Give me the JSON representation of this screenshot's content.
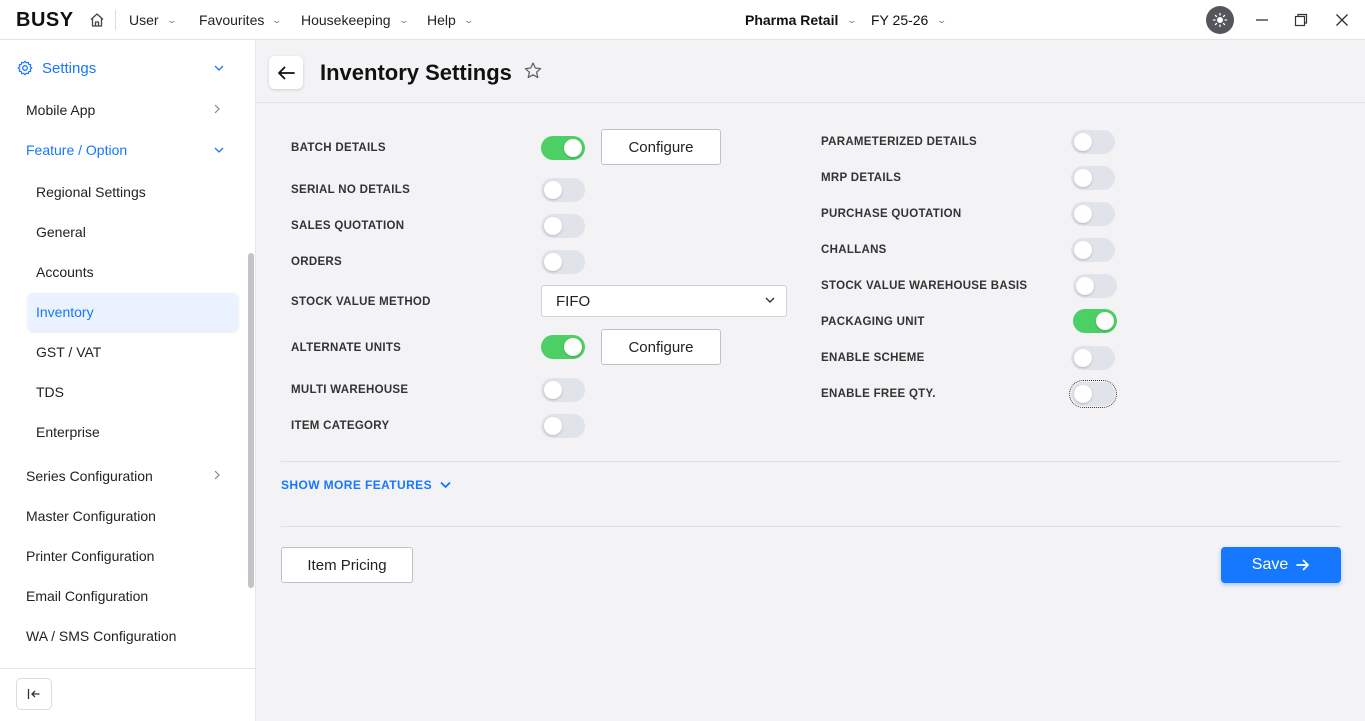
{
  "app": {
    "logo": "BUSY",
    "menus": [
      {
        "label": "User"
      },
      {
        "label": "Favourites"
      },
      {
        "label": "Housekeeping"
      },
      {
        "label": "Help"
      }
    ],
    "company": "Pharma Retail",
    "fiscal_year": "FY 25-26"
  },
  "sidebar": {
    "settings_label": "Settings",
    "items": [
      {
        "label": "Mobile App"
      },
      {
        "label": "Feature / Option"
      },
      {
        "label": "Regional Settings"
      },
      {
        "label": "General"
      },
      {
        "label": "Accounts"
      },
      {
        "label": "Inventory"
      },
      {
        "label": "GST / VAT"
      },
      {
        "label": "TDS"
      },
      {
        "label": "Enterprise"
      },
      {
        "label": "Series Configuration"
      },
      {
        "label": "Master Configuration"
      },
      {
        "label": "Printer Configuration"
      },
      {
        "label": "Email Configuration"
      },
      {
        "label": "WA / SMS Configuration"
      }
    ]
  },
  "page": {
    "title": "Inventory Settings"
  },
  "left_options": [
    {
      "label": "BATCH DETAILS",
      "on": true,
      "configure": "Configure"
    },
    {
      "label": "SERIAL NO DETAILS",
      "on": false
    },
    {
      "label": "SALES QUOTATION",
      "on": false
    },
    {
      "label": "ORDERS",
      "on": false
    },
    {
      "label": "STOCK VALUE METHOD",
      "value": "FIFO"
    },
    {
      "label": "ALTERNATE UNITS",
      "on": true,
      "configure": "Configure"
    },
    {
      "label": "MULTI WAREHOUSE",
      "on": false
    },
    {
      "label": "ITEM CATEGORY",
      "on": false
    }
  ],
  "right_options": [
    {
      "label": "PARAMETERIZED DETAILS",
      "on": false
    },
    {
      "label": "MRP DETAILS",
      "on": false
    },
    {
      "label": "PURCHASE QUOTATION",
      "on": false
    },
    {
      "label": "CHALLANS",
      "on": false
    },
    {
      "label": "STOCK VALUE WAREHOUSE BASIS",
      "on": false
    },
    {
      "label": "PACKAGING UNIT",
      "on": true
    },
    {
      "label": "ENABLE SCHEME",
      "on": false
    },
    {
      "label": "ENABLE FREE QTY.",
      "on": false
    }
  ],
  "show_more_label": "SHOW MORE FEATURES",
  "footer": {
    "item_pricing_label": "Item Pricing",
    "save_label": "Save"
  },
  "colors": {
    "accent": "#1677ff",
    "toggle_on": "#4cd066",
    "toggle_off": "#e1e3ea"
  }
}
